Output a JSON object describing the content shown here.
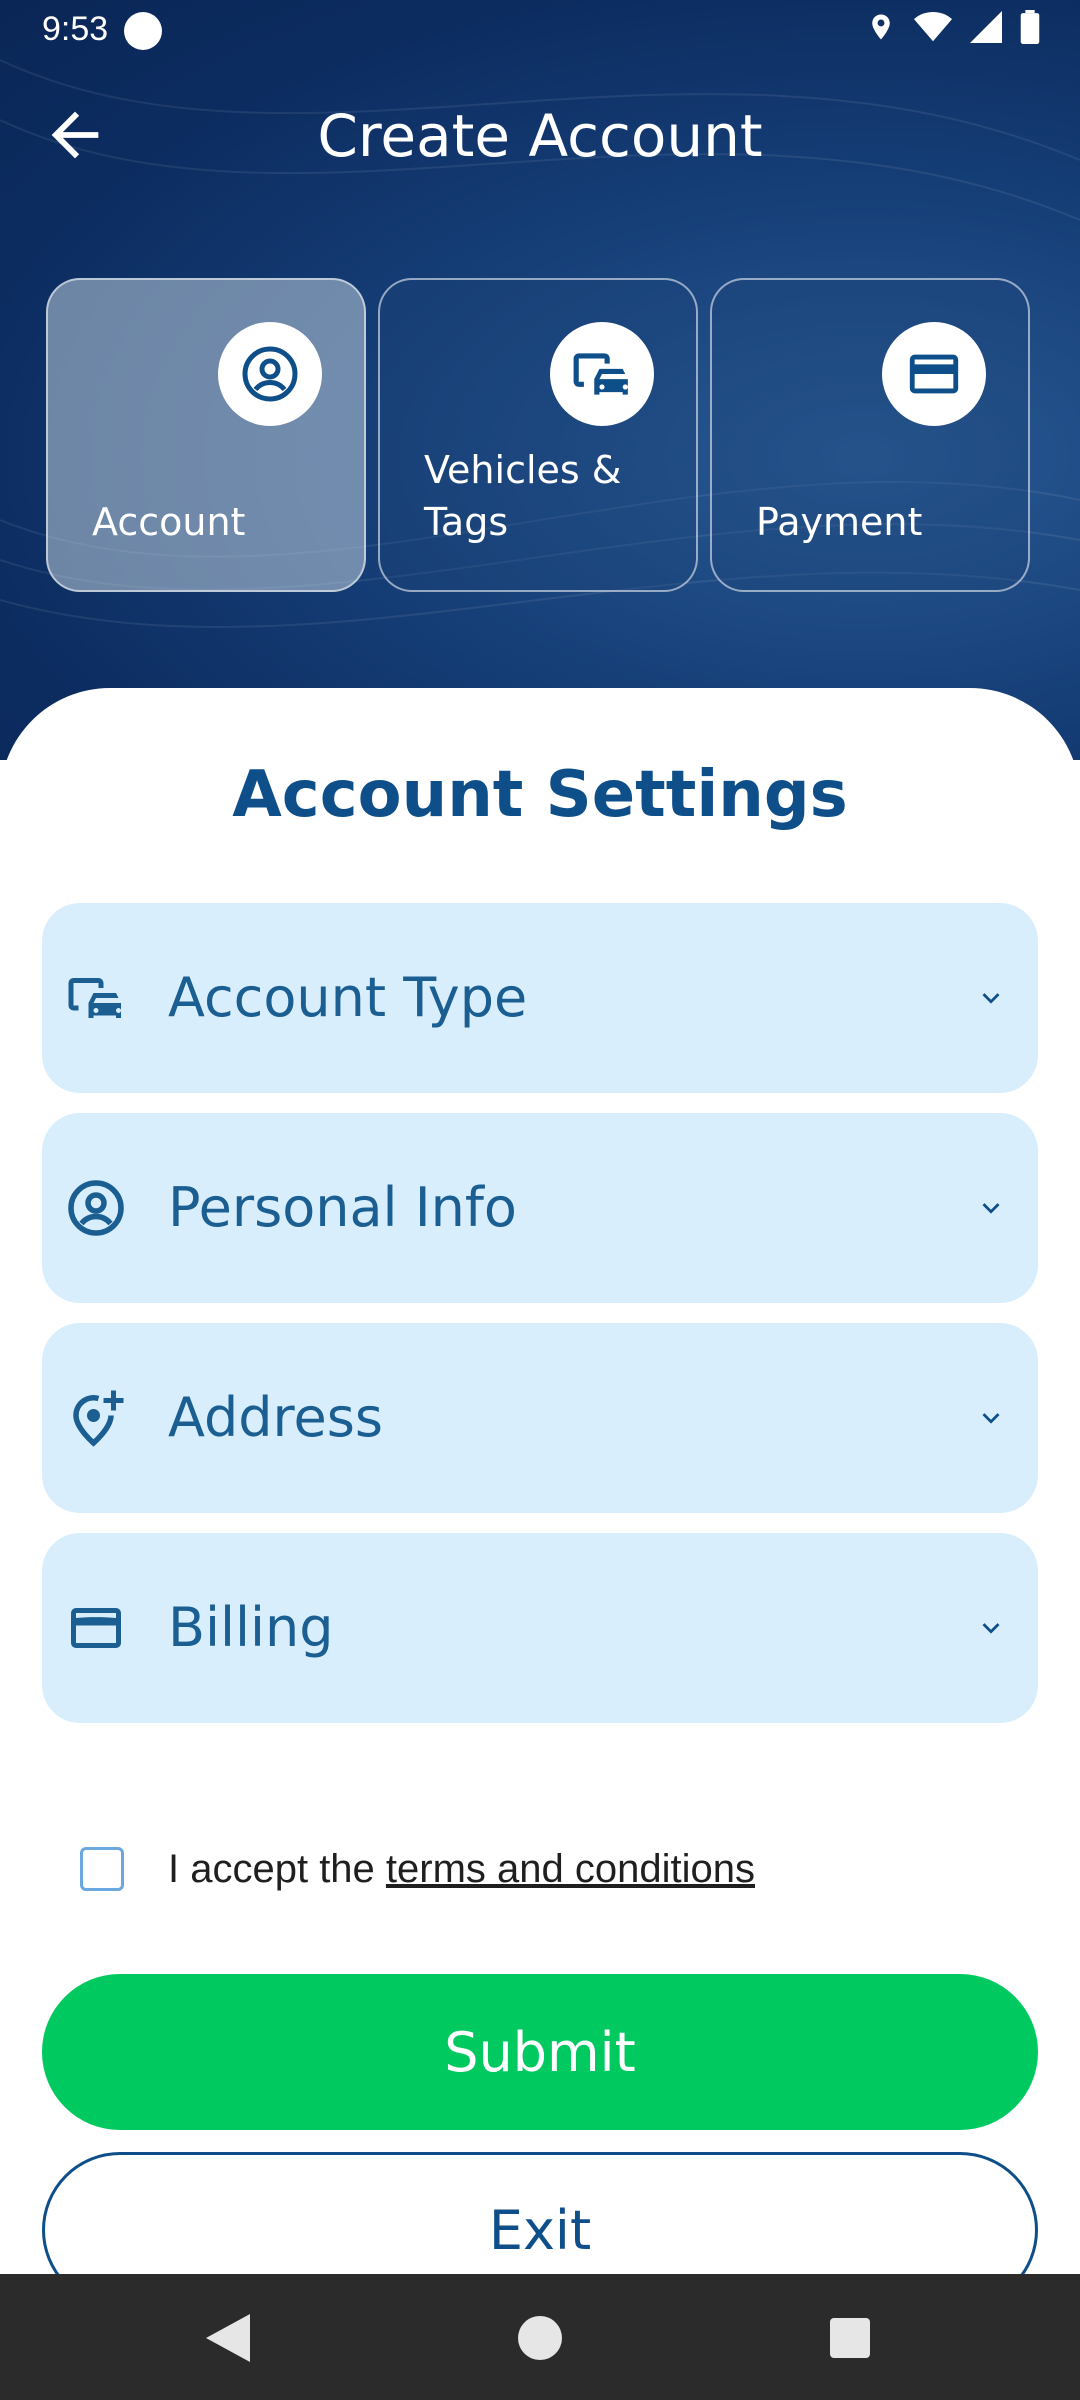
{
  "status": {
    "time": "9:53"
  },
  "header": {
    "title": "Create Account"
  },
  "steps": [
    {
      "label": "Account",
      "icon": "account-circle-icon",
      "active": true
    },
    {
      "label_line1": "Vehicles &",
      "label_line2": "Tags",
      "icon": "vehicles-icon",
      "active": false
    },
    {
      "label": "Payment",
      "icon": "credit-card-icon",
      "active": false
    }
  ],
  "section": {
    "title": "Account Settings"
  },
  "accordion": [
    {
      "label": "Account Type",
      "icon": "vehicles-icon"
    },
    {
      "label": "Personal Info",
      "icon": "account-circle-icon"
    },
    {
      "label": "Address",
      "icon": "add-location-icon"
    },
    {
      "label": "Billing",
      "icon": "wallet-icon"
    }
  ],
  "terms": {
    "prefix": "I accept the ",
    "link": "terms and conditions",
    "checked": false
  },
  "buttons": {
    "submit": "Submit",
    "exit": "Exit"
  },
  "colors": {
    "primary": "#0e4f8a",
    "accent_green": "#00c95f",
    "row_bg": "#d9eefc"
  }
}
